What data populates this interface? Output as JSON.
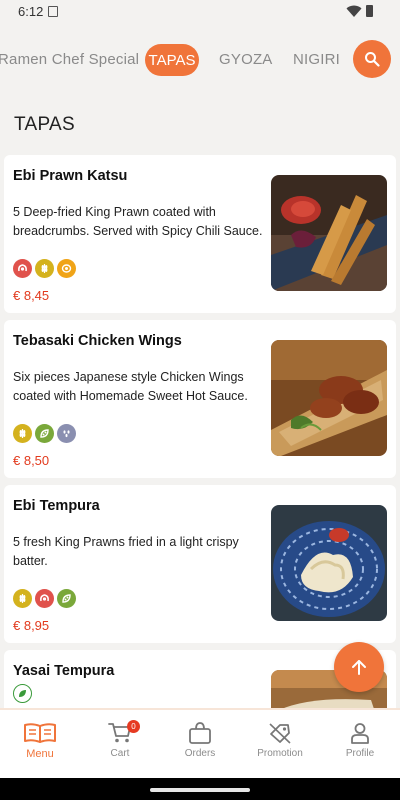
{
  "status": {
    "time": "6:12"
  },
  "categories": [
    "Ramen Chef Special",
    "TAPAS",
    "GYOZA",
    "NIGIRI"
  ],
  "active_category": "TAPAS",
  "section_title": "TAPAS",
  "dishes": [
    {
      "name": "Ebi Prawn Katsu",
      "description": "5 Deep-fried King Prawn coated with breadcrumbs. Served with Spicy Chili Sauce.",
      "price": "€ 8,45",
      "allergens": [
        "crustacean-icon",
        "gluten-icon",
        "egg-icon"
      ]
    },
    {
      "name": "Tebasaki Chicken Wings",
      "description": "Six pieces Japanese style Chicken Wings coated with Homemade Sweet Hot Sauce.",
      "price": "€ 8,50",
      "allergens": [
        "gluten-icon",
        "soy-icon",
        "sesame-icon"
      ]
    },
    {
      "name": "Ebi Tempura",
      "description": "5 fresh King Prawns fried in a light crispy batter.",
      "price": "€ 8,95",
      "allergens": [
        "gluten-icon",
        "crustacean-icon",
        "soy-icon"
      ]
    },
    {
      "name": "Yasai Tempura",
      "description": "",
      "price": "",
      "allergens": [
        "vegan-icon"
      ]
    }
  ],
  "nav": {
    "menu": "Menu",
    "cart": "Cart",
    "cart_count": "0",
    "orders": "Orders",
    "promotion": "Promotion",
    "profile": "Profile"
  },
  "colors": {
    "accent": "#f0743a",
    "price": "#e23a1d",
    "background": "#f3f2f0"
  }
}
